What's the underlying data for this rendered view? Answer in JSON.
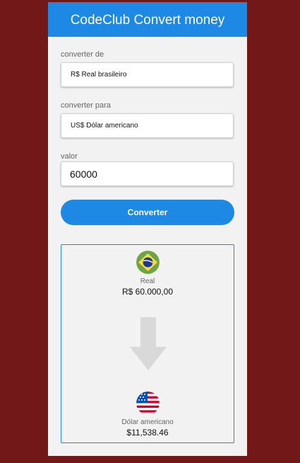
{
  "header": {
    "title": "CodeClub Convert money"
  },
  "form": {
    "from_label": "converter de",
    "from_value": "R$ Real brasileiro",
    "to_label": "converter para",
    "to_value": "US$ Dólar americano",
    "amount_label": "valor",
    "amount_value": "60000",
    "convert_label": "Converter"
  },
  "result": {
    "from_currency_name": "Real",
    "from_amount": "R$ 60.000,00",
    "to_currency_name": "Dólar americano",
    "to_amount": "$11,538.46"
  },
  "icons": {
    "from_flag": "brazil-flag-icon",
    "arrow": "arrow-down-icon",
    "to_flag": "usa-flag-icon"
  },
  "colors": {
    "background": "#721818",
    "accent": "#1e88e5",
    "card": "#f2f2f2"
  }
}
